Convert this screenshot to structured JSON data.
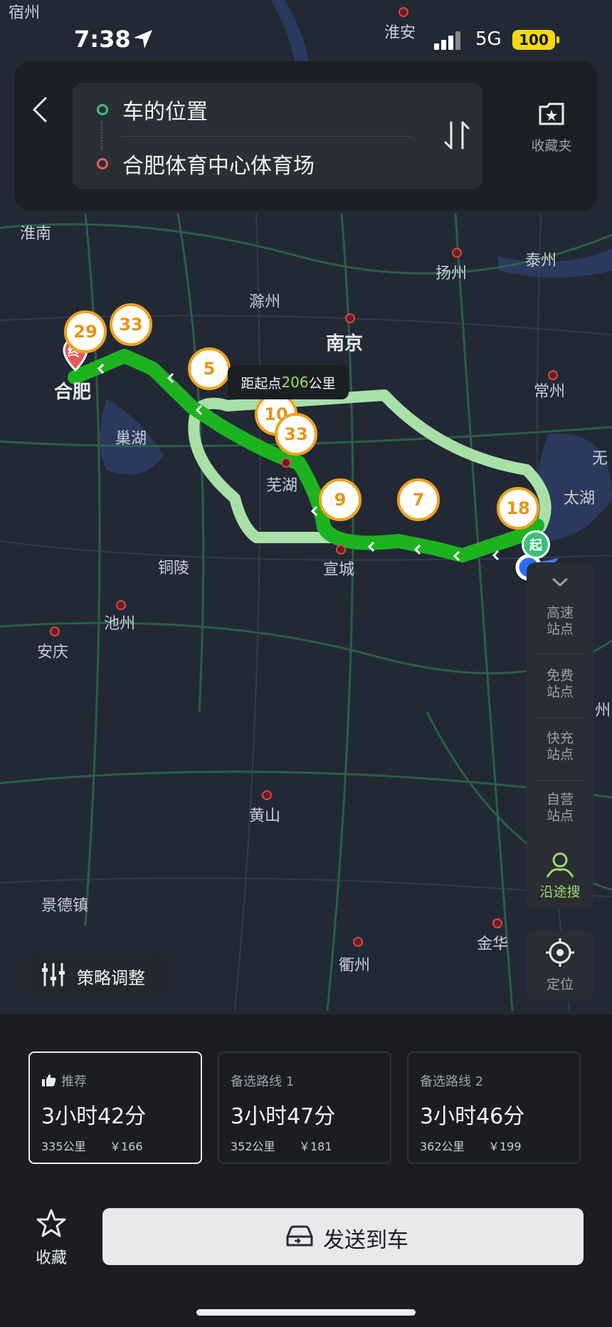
{
  "status_bar": {
    "time": "7:38",
    "network": "5G",
    "battery": "100"
  },
  "route": {
    "origin": "车的位置",
    "destination": "合肥体育中心体育场",
    "favorites_label": "收藏夹"
  },
  "map": {
    "cities": [
      "宿州",
      "淮安",
      "淮南",
      "扬州",
      "泰州",
      "滁州",
      "南京",
      "合肥",
      "常州",
      "巢湖",
      "无",
      "太湖",
      "芜湖",
      "铜陵",
      "宣城",
      "池州",
      "安庆",
      "州",
      "黄山",
      "景德镇",
      "金华",
      "衢州"
    ],
    "traffic_badges": [
      "29",
      "33",
      "5",
      "10",
      "33",
      "9",
      "7",
      "18"
    ],
    "end_marker": "终",
    "start_marker": "起",
    "distance_tooltip": {
      "prefix": "距起点",
      "value": "206",
      "unit": "公里"
    }
  },
  "side_panel": {
    "items": [
      "高速站点",
      "免费站点",
      "快充站点",
      "自营站点"
    ],
    "search_along": "沿途搜",
    "locate": "定位"
  },
  "strategy_button": "策略调整",
  "routes": [
    {
      "label": "推荐",
      "time": "3小时42分",
      "distance": "335公里",
      "toll": "￥166"
    },
    {
      "label": "备选路线 1",
      "time": "3小时47分",
      "distance": "352公里",
      "toll": "￥181"
    },
    {
      "label": "备选路线 2",
      "time": "3小时46分",
      "distance": "362公里",
      "toll": "￥199"
    }
  ],
  "bottom_bar": {
    "favorite": "收藏",
    "send": "发送到车"
  },
  "colors": {
    "route_main": "#1db31f",
    "route_alt": "#a8e0a8",
    "badge_border": "#f0a21c",
    "accent_green": "#3ac07a",
    "dest_red": "#e35a5a"
  }
}
